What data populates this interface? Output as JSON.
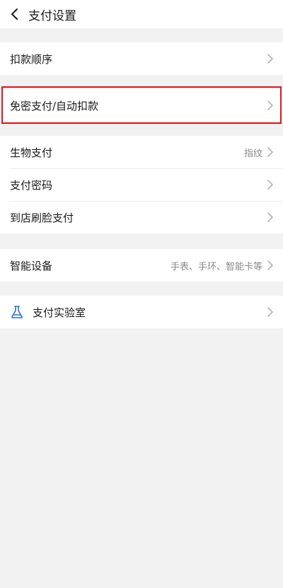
{
  "header": {
    "title": "支付设置"
  },
  "groups": {
    "payment_order": {
      "label": "扣款顺序"
    },
    "auto_debit": {
      "label": "免密支付/自动扣款"
    },
    "security": {
      "biometric": {
        "label": "生物支付",
        "value": "指纹"
      },
      "password": {
        "label": "支付密码"
      },
      "face_pay": {
        "label": "到店刷脸支付"
      }
    },
    "smart_devices": {
      "label": "智能设备",
      "value": "手表、手环、智能卡等"
    },
    "lab": {
      "label": "支付实验室",
      "icon": "flask-icon"
    }
  },
  "colors": {
    "highlight_border": "#e0141a",
    "lab_icon": "#2a6fdb",
    "background": "#f2f2f2",
    "chevron": "#b3b3b3"
  }
}
